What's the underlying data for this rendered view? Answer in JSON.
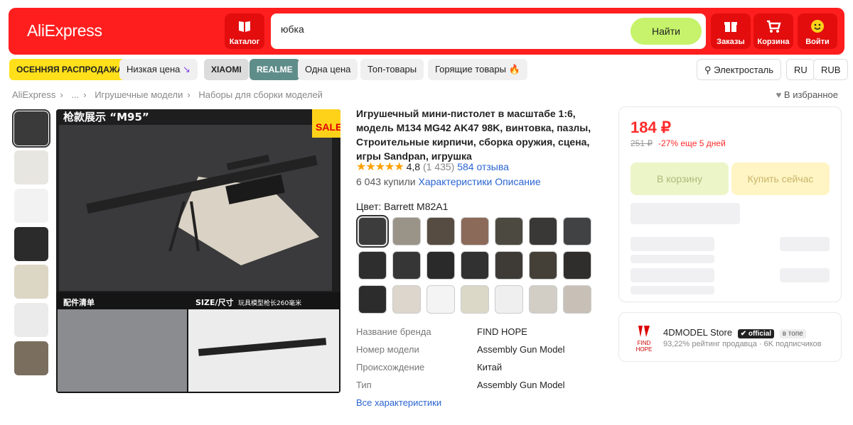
{
  "header": {
    "logo": "AliExpress",
    "catalog_label": "Каталог",
    "search_value": "юбка",
    "search_button": "Найти",
    "orders_label": "Заказы",
    "cart_label": "Корзина",
    "login_label": "Войти"
  },
  "pills": [
    {
      "label": "ОСЕННЯЯ РАСПРОДАЖА"
    },
    {
      "label": "Низкая цена"
    },
    {
      "label": "XIAOMI"
    },
    {
      "label": "REALME"
    },
    {
      "label": "Одна цена"
    },
    {
      "label": "Топ-товары"
    },
    {
      "label": "Горящие товары"
    }
  ],
  "region": {
    "city": "Электросталь",
    "lang": "RU",
    "currency": "RUB"
  },
  "breadcrumbs": [
    "AliExpress",
    "...",
    "Игрушечные модели",
    "Наборы для сборки моделей"
  ],
  "favorite_label": "В избранное",
  "main_image": {
    "caption_top": "枪款展示 “M95”",
    "sale_badge": "SALE",
    "caption_left": "配件清单",
    "caption_right": "SIZE/尺寸",
    "caption_right_sub": "玩具模型枪长260毫米"
  },
  "product": {
    "title": "Игрушечный мини-пистолет в масштабе 1:6, модель M134 MG42 AK47 98K, винтовка, пазлы, Строительные кирпичи, сборка оружия, сцена, игры Sandpan, игрушка",
    "stars": "★★★★★",
    "rating": "4,8",
    "rating_count": "(1 435)",
    "reviews": "584 отзыва",
    "sold": "6 043 купили",
    "characteristics_link": "Характеристики",
    "description_link": "Описание",
    "color_label": "Цвет: Barrett M82A1"
  },
  "props": [
    {
      "k": "Название бренда",
      "v": "FIND HOPE"
    },
    {
      "k": "Номер модели",
      "v": "Assembly Gun Model"
    },
    {
      "k": "Происхождение",
      "v": "Китай"
    },
    {
      "k": "Тип",
      "v": "Assembly Gun Model"
    }
  ],
  "all_props_link": "Все характеристики",
  "buy": {
    "price": "184 ₽",
    "old_price": "251 ₽",
    "discount": "-27% еще 5 дней",
    "cart_button": "В корзину",
    "buy_now_button": "Купить сейчас"
  },
  "store": {
    "name": "4DMODEL Store",
    "official": "official",
    "top": "в топе",
    "info": "93,22% рейтинг продавца · 6K подписчиков",
    "logo_text": "FIND HOPE"
  },
  "colors": {
    "brand": "#ff1e1e",
    "search_button": "#c6f36b",
    "sale_pill": "#ffe01a",
    "price": "#ff2a2a",
    "link": "#2a64d1"
  }
}
